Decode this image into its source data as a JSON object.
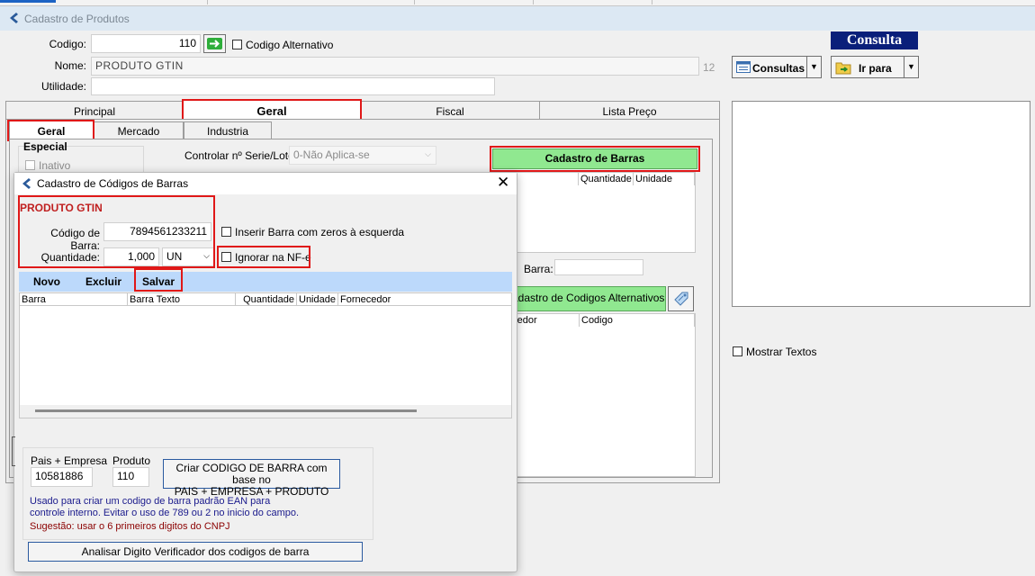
{
  "window": {
    "title": "Cadastro de Produtos"
  },
  "form": {
    "codigo_label": "Codigo:",
    "codigo_value": "110",
    "codigo_alternativo_label": "Codigo Alternativo",
    "nome_label": "Nome:",
    "nome_value": "PRODUTO GTIN",
    "nome_count": "12",
    "utilidade_label": "Utilidade:",
    "utilidade_value": ""
  },
  "consulta": {
    "title": "Consulta",
    "consultas_button": "Consultas",
    "ir_para_button": "Ir para",
    "mostrar_textos_label": "Mostrar Textos"
  },
  "main_tabs": [
    "Principal",
    "Geral",
    "Fiscal",
    "Lista Preço"
  ],
  "sub_tabs": [
    "Geral",
    "Mercado",
    "Industria"
  ],
  "geral_panel": {
    "especial_label": "Especial",
    "inativo_label": "Inativo",
    "controlar_label": "Controlar nº Serie/Lote:",
    "controlar_value": "0-Não Aplica-se",
    "cadastro_barras_button": "Cadastro de Barras",
    "barras_columns": [
      "a",
      "Quantidade",
      "Unidade"
    ],
    "barra_label": "Barra:",
    "barra_value": "",
    "alt_codes_button": "adastro de Codigos Alternativos",
    "alt_columns": [
      "ecedor",
      "Codigo"
    ]
  },
  "dialog": {
    "title": "Cadastro de Códigos de Barras",
    "product_name": "PRODUTO GTIN",
    "codigo_barra_label": "Código de Barra:",
    "codigo_barra_value": "7894561233211",
    "quantidade_label": "Quantidade:",
    "quantidade_value": "1,000",
    "unidade_value": "UN",
    "inserir_zeros_label": "Inserir Barra com zeros à esquerda",
    "ignorar_nfe_label": "Ignorar na NF-e",
    "toolbar": {
      "novo": "Novo",
      "excluir": "Excluir",
      "salvar": "Salvar"
    },
    "columns": [
      "Barra",
      "Barra Texto",
      "Quantidade",
      "Unidade",
      "Fornecedor"
    ],
    "pais_empresa_label": "Pais + Empresa",
    "pais_empresa_value": "10581886",
    "produto_label": "Produto",
    "produto_value": "110",
    "criar_button_line1": "Criar CODIGO DE BARRA com base no",
    "criar_button_line2": "PAIS + EMPRESA + PRODUTO",
    "note_line1": "Usado para criar um codigo de barra padrão EAN para",
    "note_line2": "controle interno. Evitar o uso de 789 ou 2 no inicio do campo.",
    "suggestion": "Sugestão: usar o 6 primeiros digitos do CNPJ",
    "analisar_button": "Analisar Digito Verificador dos codigos de barra"
  },
  "colors": {
    "highlight_red": "#e01818",
    "green_button": "#90e890",
    "consulta_title_bg": "#0a1f7a",
    "dialog_toolbar": "#bcd9fb",
    "note_blue": "#1a1a8c",
    "note_red": "#8b0000"
  }
}
